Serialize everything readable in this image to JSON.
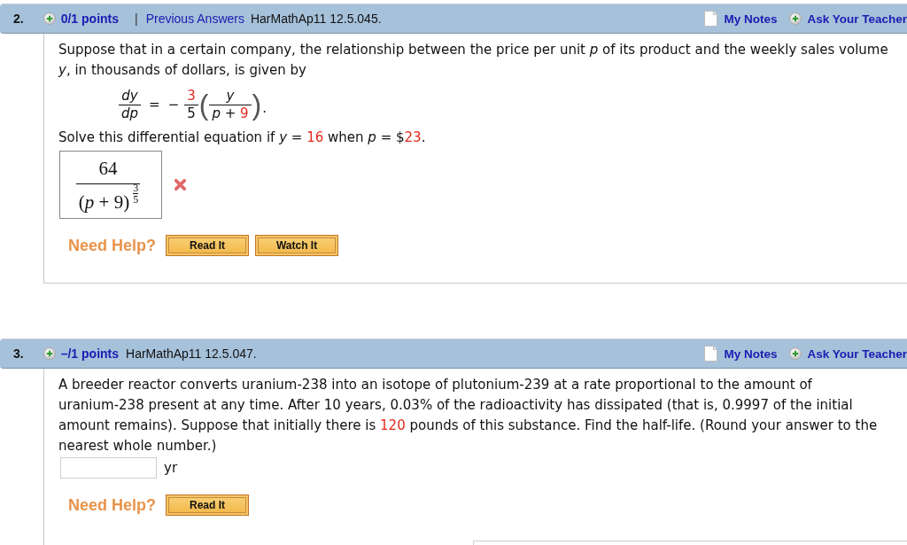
{
  "questions": [
    {
      "number": "2.",
      "points": "0/1 points",
      "separator": "|",
      "previous_answers": "Previous Answers",
      "source": "HarMathAp11 12.5.045.",
      "notes_link": "My Notes",
      "ask_link": "Ask Your Teacher",
      "content": [
        {
          "kind": "text",
          "segments": [
            {
              "text": "Suppose that in a certain company, the relationship between the price per unit *p* of its product and the weekly sales volume *y*, in thousands of dollars, is given by",
              "highlighted": false
            }
          ]
        },
        {
          "kind": "equation",
          "lhs_numerator": "*dy*",
          "lhs_denominator": "*dp*",
          "relation": "=",
          "sign": "−",
          "coefficient_numerator": [
            {
              "text": "3",
              "highlighted": true
            }
          ],
          "coefficient_denominator": [
            {
              "text": "5",
              "highlighted": false
            }
          ],
          "open_bracket": "(",
          "inner_numerator": [
            {
              "text": "*y*",
              "highlighted": false
            }
          ],
          "inner_denominator": [
            {
              "text": "*p* + ",
              "highlighted": false
            },
            {
              "text": "9",
              "highlighted": true
            }
          ],
          "close_bracket": ")",
          "end": "."
        },
        {
          "kind": "text",
          "segments": [
            {
              "text": "Solve this differential equation if  *y* = ",
              "highlighted": false
            },
            {
              "text": "16",
              "highlighted": true
            },
            {
              "text": "  when *p* = $",
              "highlighted": false
            },
            {
              "text": "23",
              "highlighted": true
            },
            {
              "text": ".",
              "highlighted": false
            }
          ]
        },
        {
          "kind": "answer",
          "numerator": "64",
          "denominator": "(*p* + 9)",
          "exponent_numerator": "3",
          "exponent_denominator": "5",
          "correct": false
        }
      ],
      "help": {
        "label": "Need Help?",
        "buttons": [
          "Read It",
          "Watch It"
        ]
      }
    },
    {
      "number": "3.",
      "points": "–/1 points",
      "source": "HarMathAp11 12.5.047.",
      "notes_link": "My Notes",
      "ask_link": "Ask Your Teacher",
      "content": [
        {
          "kind": "text",
          "segments": [
            {
              "text": "A breeder reactor converts uranium-238 into an isotope of plutonium-239 at a rate proportional to the amount of uranium-238 present at any time. After 10 years, 0.03% of the radioactivity has dissipated (that is, 0.9997 of the initial amount remains). Suppose that initially there is ",
              "highlighted": false
            },
            {
              "text": "120",
              "highlighted": true
            },
            {
              "text": " pounds of this substance. Find the half-life. (Round your answer to the nearest whole number.)",
              "highlighted": false
            }
          ]
        },
        {
          "kind": "field",
          "unit": "yr"
        }
      ],
      "help": {
        "label": "Need Help?",
        "buttons": [
          "Read It"
        ]
      }
    }
  ]
}
